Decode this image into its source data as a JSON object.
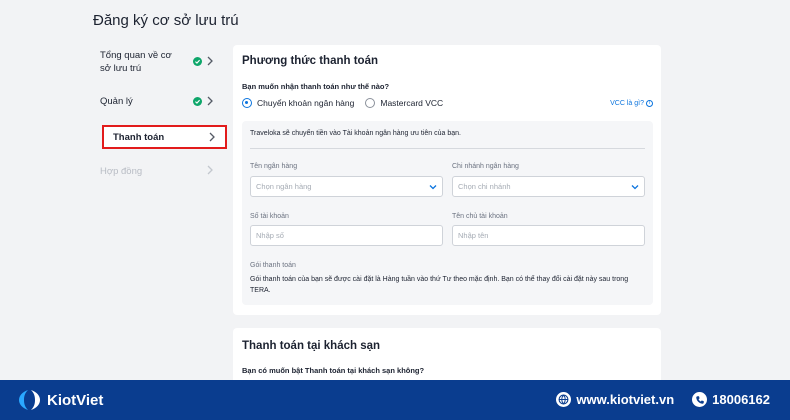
{
  "page": {
    "title": "Đăng ký cơ sở lưu trú"
  },
  "sidebar": {
    "items": [
      {
        "label": "Tổng quan về cơ sở lưu trú",
        "status": "done"
      },
      {
        "label": "Quản lý",
        "status": "done"
      },
      {
        "label": "Thanh toán",
        "status": "active"
      },
      {
        "label": "Hợp đồng",
        "status": "disabled"
      }
    ]
  },
  "payment": {
    "title": "Phương thức thanh toán",
    "question": "Bạn muốn nhận thanh toán như thế nào?",
    "options": [
      {
        "label": "Chuyển khoản ngân hàng",
        "selected": true
      },
      {
        "label": "Mastercard VCC",
        "selected": false
      }
    ],
    "vcc_link": "VCC là gì?",
    "note": "Traveloka sẽ chuyển tiền vào Tài khoản ngân hàng ưu tiên của bạn.",
    "fields": {
      "bank_name": {
        "label": "Tên ngân hàng",
        "placeholder": "Chọn ngân hàng"
      },
      "bank_branch": {
        "label": "Chi nhánh ngân hàng",
        "placeholder": "Chọn chi nhánh"
      },
      "account_number": {
        "label": "Số tài khoản",
        "placeholder": "Nhập số"
      },
      "account_holder": {
        "label": "Tên chủ tài khoản",
        "placeholder": "Nhập tên"
      }
    },
    "package_label": "Gói thanh toán",
    "package_text": "Gói thanh toán của bạn sẽ được cài đặt là Hàng tuần vào thứ Tư theo mặc định. Bạn có thể thay đổi cài đặt này sau trong TERA."
  },
  "hotel_payment": {
    "title": "Thanh toán tại khách sạn",
    "question": "Bạn có muốn bật Thanh toán tại khách sạn không?"
  },
  "footer": {
    "brand": "KiotViet",
    "website": "www.kiotviet.vn",
    "phone": "18006162"
  },
  "colors": {
    "accent": "#0b74de",
    "success": "#0ea66a",
    "highlight": "#e21b1b",
    "footer_bg": "#0a3d8f"
  }
}
